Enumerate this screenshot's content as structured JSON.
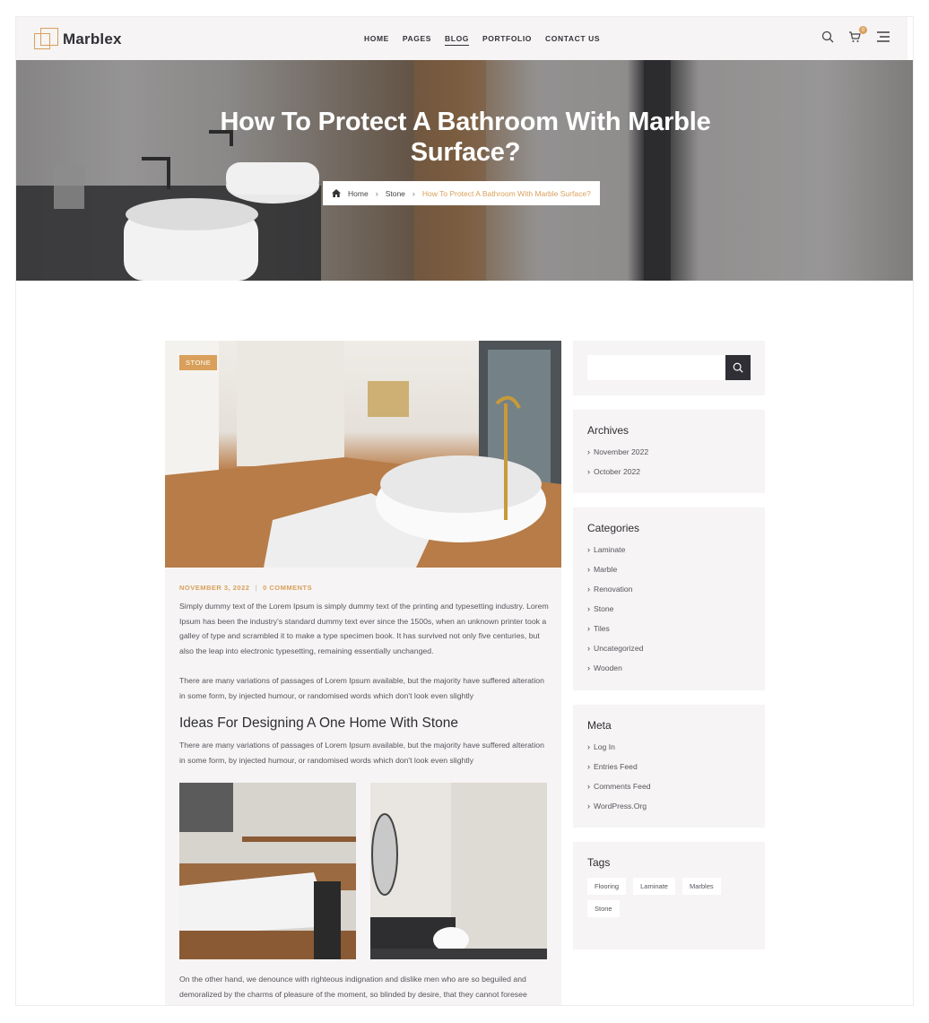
{
  "header": {
    "logo_text": "Marblex",
    "nav": [
      "HOME",
      "PAGES",
      "BLOG",
      "PORTFOLIO",
      "CONTACT US"
    ],
    "active_nav": "BLOG",
    "cart_count": "0"
  },
  "hero": {
    "title_line1": "How To Protect A Bathroom With Marble",
    "title_line2": "Surface?",
    "breadcrumb": {
      "home": "Home",
      "category": "Stone",
      "current": "How To Protect A Bathroom With Marble Surface?"
    }
  },
  "post": {
    "category_tag": "STONE",
    "date": "NOVEMBER 3, 2022",
    "comments": "0 COMMENTS",
    "paragraph1": "Simply dummy text of the Lorem Ipsum is simply dummy text of the printing and typesetting industry. Lorem Ipsum has been the industry's standard dummy text ever since the 1500s, when an unknown printer took a galley of type and scrambled it to make a type specimen book. It has survived not only five centuries, but also the leap into electronic typesetting, remaining essentially unchanged.",
    "paragraph2": "There are many variations of passages of Lorem Ipsum available, but the majority have suffered alteration in some form, by injected humour, or randomised words which don't look even slightly",
    "heading": "Ideas For Designing A One Home With Stone",
    "paragraph3": "There are many variations of passages of Lorem Ipsum available, but the majority have suffered alteration in some form, by injected humour, or randomised words which don't look even slightly",
    "paragraph4": "On the other hand, we denounce with righteous indignation and dislike men who are so beguiled and demoralized by the charms of pleasure of the moment, so blinded by desire, that they cannot foresee"
  },
  "sidebar": {
    "archives": {
      "title": "Archives",
      "items": [
        "November 2022",
        "October 2022"
      ]
    },
    "categories": {
      "title": "Categories",
      "items": [
        "Laminate",
        "Marble",
        "Renovation",
        "Stone",
        "Tiles",
        "Uncategorized",
        "Wooden"
      ]
    },
    "meta": {
      "title": "Meta",
      "items": [
        "Log In",
        "Entries Feed",
        "Comments Feed",
        "WordPress.Org"
      ]
    },
    "tags": {
      "title": "Tags",
      "items": [
        "Flooring",
        "Laminate",
        "Marbles",
        "Stone"
      ]
    }
  },
  "colors": {
    "accent": "#d9a05b",
    "dark": "#2f2f35",
    "panel": "#f6f4f4"
  },
  "icons": [
    "search-icon",
    "cart-icon",
    "menu-icon",
    "home-icon",
    "chevron-right-icon"
  ]
}
